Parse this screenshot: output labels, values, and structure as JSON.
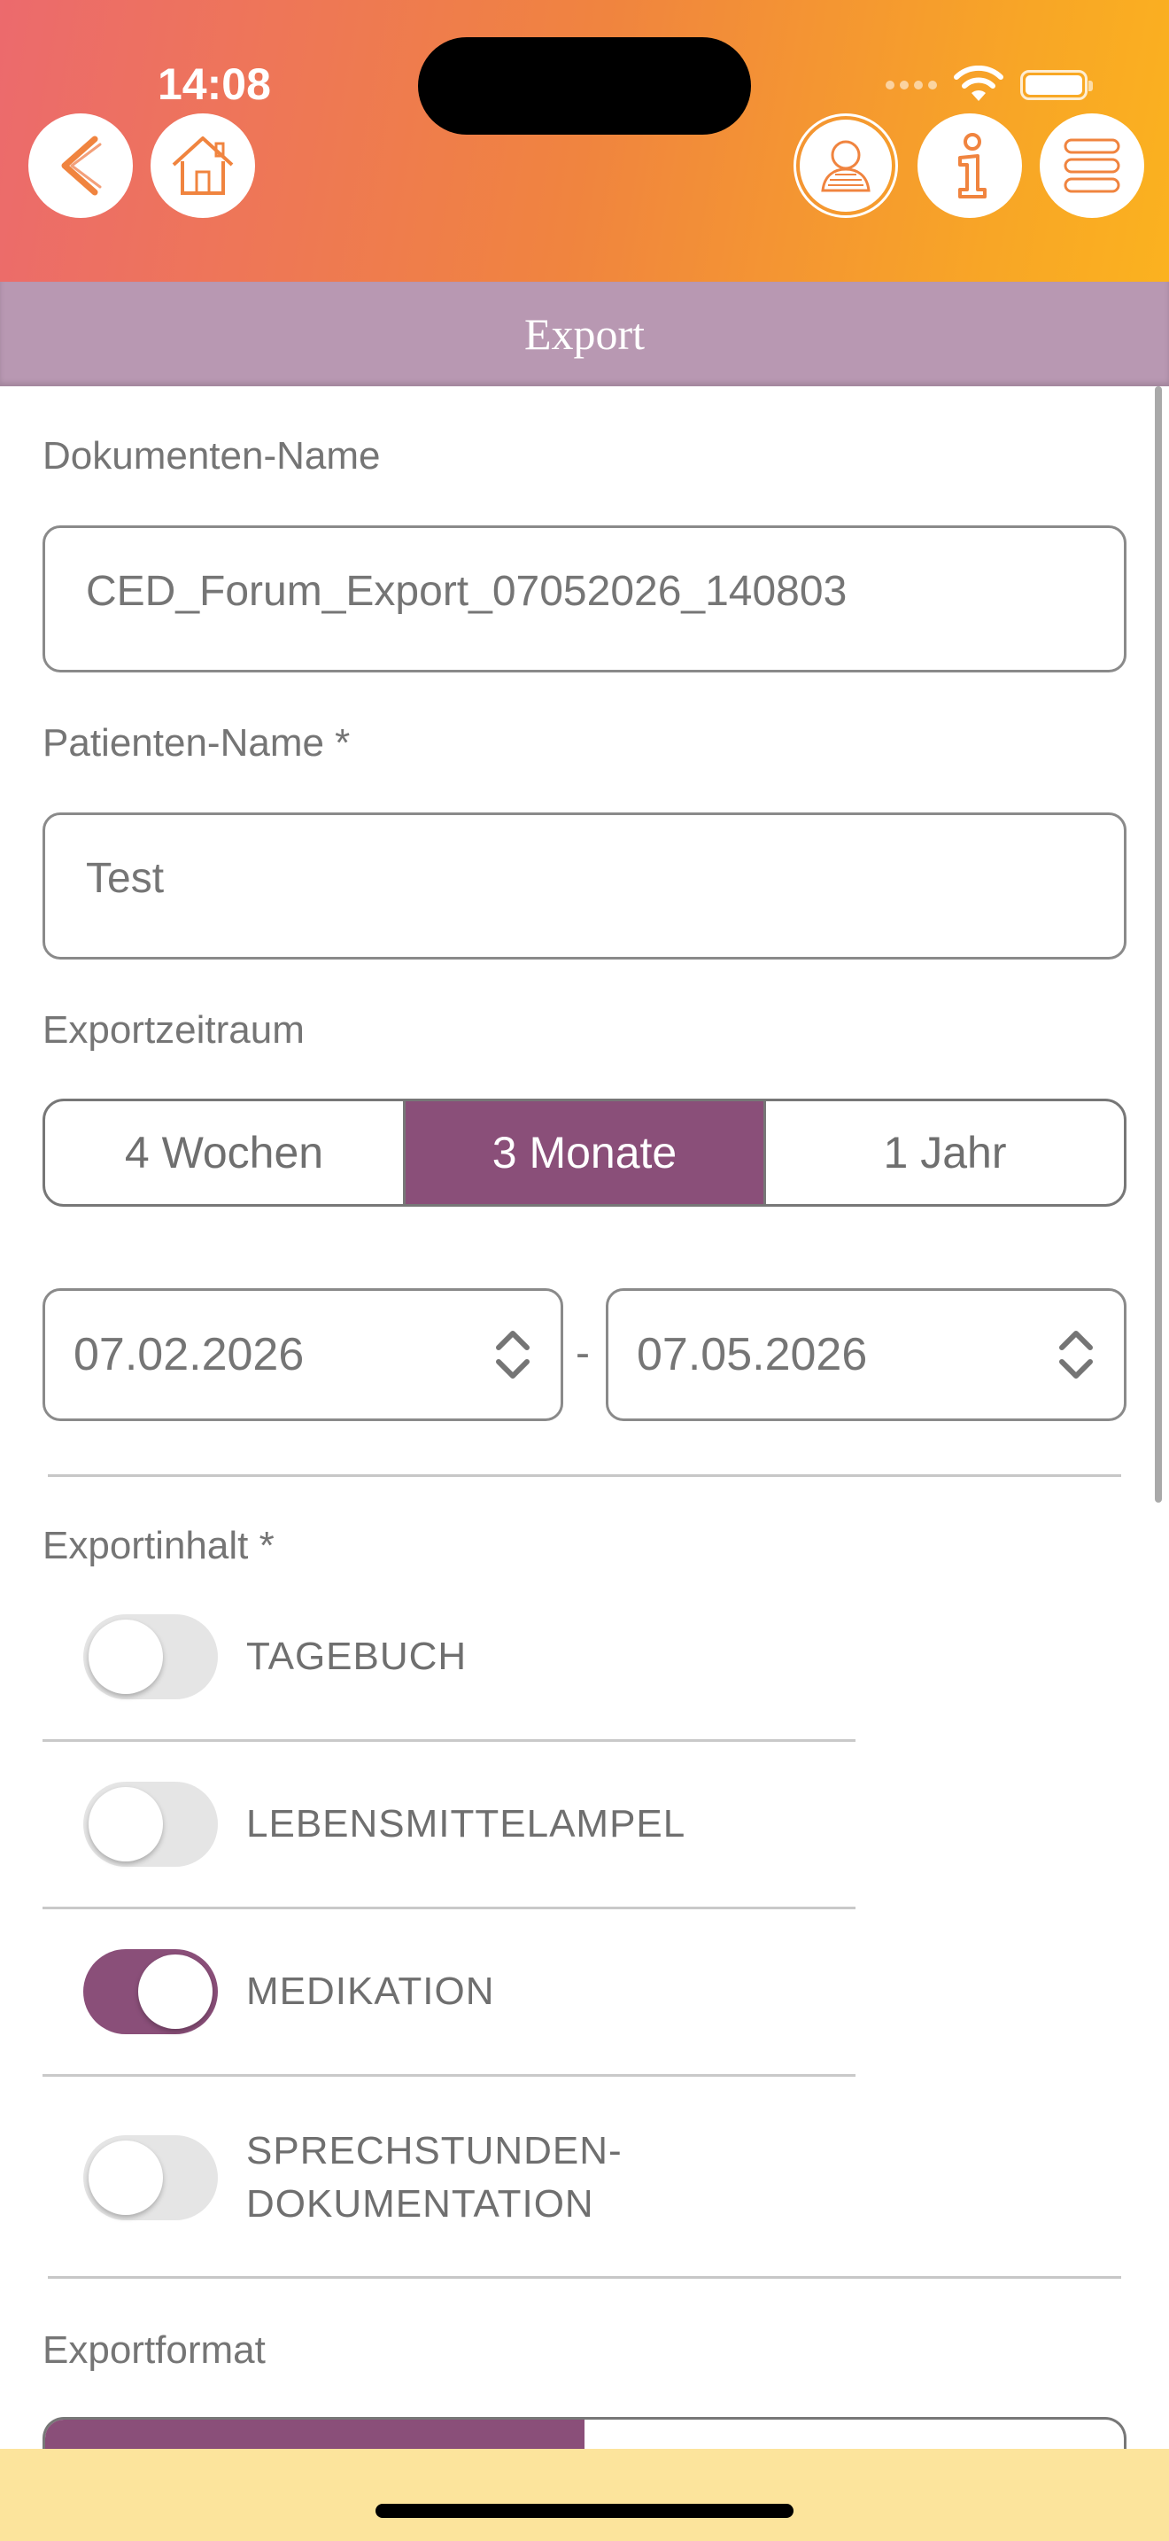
{
  "status_bar": {
    "time": "14:08"
  },
  "header": {
    "back_icon": "back-arrow-icon",
    "home_icon": "home-icon",
    "profile_icon": "user-profile-icon",
    "info_icon": "info-icon",
    "menu_icon": "menu-icon",
    "accent_color": "#f0843f"
  },
  "titlebar": {
    "title": "Export",
    "color": "#b898b2"
  },
  "form": {
    "document_name": {
      "label": "Dokumenten-Name",
      "value": "CED_Forum_Export_07052026_140803"
    },
    "patient_name": {
      "label": "Patienten-Name *",
      "value": "Test"
    },
    "export_period": {
      "label": "Exportzeitraum",
      "options": [
        "4 Wochen",
        "3 Monate",
        "1 Jahr"
      ],
      "selected": "3 Monate"
    },
    "date_range": {
      "from": "07.02.2026",
      "separator": "-",
      "to": "07.05.2026"
    },
    "export_content": {
      "label": "Exportinhalt *",
      "items": [
        {
          "label": "TAGEBUCH",
          "on": false
        },
        {
          "label": "LEBENSMITTELAMPEL",
          "on": false
        },
        {
          "label": "MEDIKATION",
          "on": true
        },
        {
          "label_line1": "SPRECHSTUNDEN-",
          "label_line2": "DOKUMENTATION",
          "on": false
        }
      ]
    },
    "export_format": {
      "label": "Exportformat"
    }
  },
  "theme": {
    "primary": "#8a4f79",
    "footer": "#fce49c"
  }
}
